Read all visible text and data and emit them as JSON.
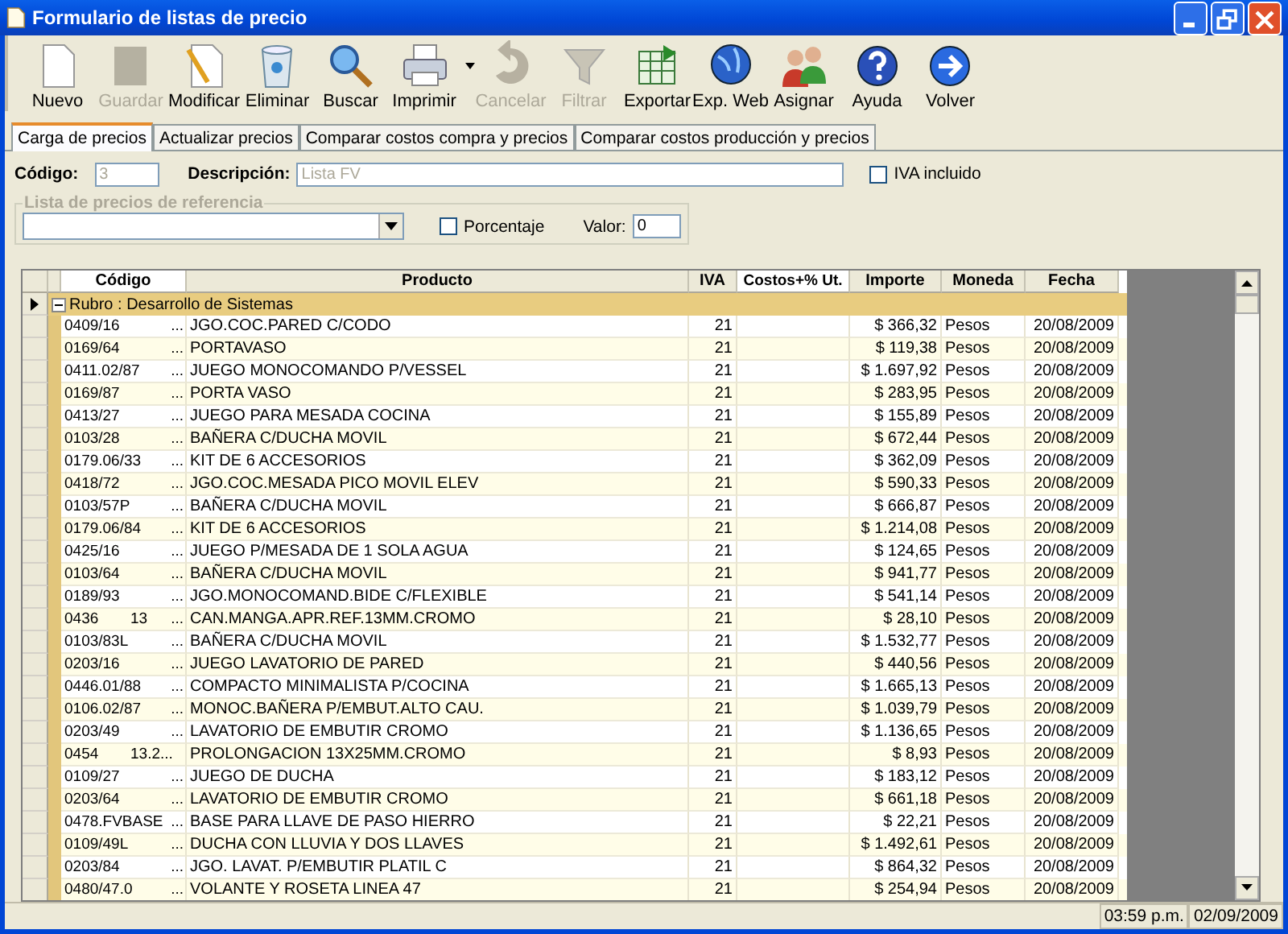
{
  "window": {
    "title": "Formulario de listas de precio"
  },
  "toolbar": [
    {
      "label": "Nuevo",
      "kind": "new",
      "disabled": false
    },
    {
      "label": "Guardar",
      "kind": "save",
      "disabled": true
    },
    {
      "label": "Modificar",
      "kind": "edit",
      "disabled": false
    },
    {
      "label": "Eliminar",
      "kind": "delete",
      "disabled": false
    },
    {
      "label": "Buscar",
      "kind": "search",
      "disabled": false
    },
    {
      "label": "Imprimir",
      "kind": "print",
      "disabled": false
    },
    {
      "label": "Cancelar",
      "kind": "cancel",
      "disabled": true
    },
    {
      "label": "Filtrar",
      "kind": "filter",
      "disabled": true
    },
    {
      "label": "Exportar",
      "kind": "export",
      "disabled": false
    },
    {
      "label": "Exp. Web",
      "kind": "web",
      "disabled": false
    },
    {
      "label": "Asignar",
      "kind": "assign",
      "disabled": false
    },
    {
      "label": "Ayuda",
      "kind": "help",
      "disabled": false
    },
    {
      "label": "Volver",
      "kind": "back",
      "disabled": false
    }
  ],
  "tabs": [
    {
      "label": "Carga de precios",
      "selected": true
    },
    {
      "label": "Actualizar precios",
      "selected": false
    },
    {
      "label": "Comparar costos compra y precios",
      "selected": false
    },
    {
      "label": "Comparar costos producción y precios",
      "selected": false
    }
  ],
  "form": {
    "codigo_label": "Código:",
    "codigo_value": "3",
    "descripcion_label": "Descripción:",
    "descripcion_value": "Lista FV",
    "iva_label": "IVA incluido",
    "iva_checked": false,
    "reference_group": {
      "legend": "Lista de precios de referencia",
      "porcentaje_label": "Porcentaje",
      "porcentaje_checked": false,
      "valor_label": "Valor:",
      "valor_value": "0"
    }
  },
  "table": {
    "columns": [
      "Código",
      "Producto",
      "IVA",
      "Costos+% Ut.",
      "Importe",
      "Moneda",
      "Fecha"
    ],
    "group": {
      "label": "Rubro : Desarrollo de Sistemas",
      "expanded": true
    },
    "rows": [
      {
        "code": "0409/16",
        "code_2": "",
        "lookup": "...",
        "product": "JGO.COC.PARED C/CODO",
        "iva": "21",
        "importe": "$ 366,32",
        "moneda": "Pesos",
        "fecha": "20/08/2009"
      },
      {
        "code": "0169/64",
        "code_2": "",
        "lookup": "...",
        "product": "PORTAVASO",
        "iva": "21",
        "importe": "$ 119,38",
        "moneda": "Pesos",
        "fecha": "20/08/2009"
      },
      {
        "code": "0411.02/87",
        "code_2": "",
        "lookup": "...",
        "product": "JUEGO MONOCOMANDO P/VESSEL",
        "iva": "21",
        "importe": "$ 1.697,92",
        "moneda": "Pesos",
        "fecha": "20/08/2009"
      },
      {
        "code": "0169/87",
        "code_2": "",
        "lookup": "...",
        "product": "PORTA VASO",
        "iva": "21",
        "importe": "$ 283,95",
        "moneda": "Pesos",
        "fecha": "20/08/2009"
      },
      {
        "code": "0413/27",
        "code_2": "",
        "lookup": "...",
        "product": "JUEGO PARA MESADA COCINA",
        "iva": "21",
        "importe": "$ 155,89",
        "moneda": "Pesos",
        "fecha": "20/08/2009"
      },
      {
        "code": "0103/28",
        "code_2": "",
        "lookup": "...",
        "product": "BAÑERA C/DUCHA MOVIL",
        "iva": "21",
        "importe": "$ 672,44",
        "moneda": "Pesos",
        "fecha": "20/08/2009"
      },
      {
        "code": "0179.06/33",
        "code_2": "",
        "lookup": "...",
        "product": "KIT DE 6 ACCESORIOS",
        "iva": "21",
        "importe": "$ 362,09",
        "moneda": "Pesos",
        "fecha": "20/08/2009"
      },
      {
        "code": "0418/72",
        "code_2": "",
        "lookup": "...",
        "product": "JGO.COC.MESADA PICO MOVIL ELEV",
        "iva": "21",
        "importe": "$ 590,33",
        "moneda": "Pesos",
        "fecha": "20/08/2009"
      },
      {
        "code": "0103/57P",
        "code_2": "",
        "lookup": "...",
        "product": "BAÑERA C/DUCHA MOVIL",
        "iva": "21",
        "importe": "$ 666,87",
        "moneda": "Pesos",
        "fecha": "20/08/2009"
      },
      {
        "code": "0179.06/84",
        "code_2": "",
        "lookup": "...",
        "product": "KIT DE 6 ACCESORIOS",
        "iva": "21",
        "importe": "$ 1.214,08",
        "moneda": "Pesos",
        "fecha": "20/08/2009"
      },
      {
        "code": "0425/16",
        "code_2": "",
        "lookup": "...",
        "product": "JUEGO P/MESADA DE 1 SOLA AGUA",
        "iva": "21",
        "importe": "$ 124,65",
        "moneda": "Pesos",
        "fecha": "20/08/2009"
      },
      {
        "code": "0103/64",
        "code_2": "",
        "lookup": "...",
        "product": "BAÑERA C/DUCHA MOVIL",
        "iva": "21",
        "importe": "$ 941,77",
        "moneda": "Pesos",
        "fecha": "20/08/2009"
      },
      {
        "code": "0189/93",
        "code_2": "",
        "lookup": "...",
        "product": "JGO.MONOCOMAND.BIDE C/FLEXIBLE",
        "iva": "21",
        "importe": "$ 541,14",
        "moneda": "Pesos",
        "fecha": "20/08/2009"
      },
      {
        "code": "0436",
        "code_2": "13",
        "lookup": "...",
        "product": "CAN.MANGA.APR.REF.13MM.CROMO",
        "iva": "21",
        "importe": "$ 28,10",
        "moneda": "Pesos",
        "fecha": "20/08/2009"
      },
      {
        "code": "0103/83L",
        "code_2": "",
        "lookup": "...",
        "product": "BAÑERA C/DUCHA MOVIL",
        "iva": "21",
        "importe": "$ 1.532,77",
        "moneda": "Pesos",
        "fecha": "20/08/2009"
      },
      {
        "code": "0203/16",
        "code_2": "",
        "lookup": "...",
        "product": "JUEGO LAVATORIO DE PARED",
        "iva": "21",
        "importe": "$ 440,56",
        "moneda": "Pesos",
        "fecha": "20/08/2009"
      },
      {
        "code": "0446.01/88",
        "code_2": "",
        "lookup": "...",
        "product": "COMPACTO MINIMALISTA P/COCINA",
        "iva": "21",
        "importe": "$ 1.665,13",
        "moneda": "Pesos",
        "fecha": "20/08/2009"
      },
      {
        "code": "0106.02/87",
        "code_2": "",
        "lookup": "...",
        "product": "MONOC.BAÑERA P/EMBUT.ALTO CAU.",
        "iva": "21",
        "importe": "$ 1.039,79",
        "moneda": "Pesos",
        "fecha": "20/08/2009"
      },
      {
        "code": "0203/49",
        "code_2": "",
        "lookup": "...",
        "product": "LAVATORIO DE EMBUTIR CROMO",
        "iva": "21",
        "importe": "$ 1.136,65",
        "moneda": "Pesos",
        "fecha": "20/08/2009"
      },
      {
        "code": "0454",
        "code_2": "13.2...",
        "lookup": "",
        "product": "PROLONGACION 13X25MM.CROMO",
        "iva": "21",
        "importe": "$ 8,93",
        "moneda": "Pesos",
        "fecha": "20/08/2009"
      },
      {
        "code": "0109/27",
        "code_2": "",
        "lookup": "...",
        "product": "JUEGO DE DUCHA",
        "iva": "21",
        "importe": "$ 183,12",
        "moneda": "Pesos",
        "fecha": "20/08/2009"
      },
      {
        "code": "0203/64",
        "code_2": "",
        "lookup": "...",
        "product": "LAVATORIO DE EMBUTIR CROMO",
        "iva": "21",
        "importe": "$ 661,18",
        "moneda": "Pesos",
        "fecha": "20/08/2009"
      },
      {
        "code": "0478.FVBASE",
        "code_2": "",
        "lookup": "...",
        "product": "BASE PARA LLAVE DE PASO HIERRO",
        "iva": "21",
        "importe": "$ 22,21",
        "moneda": "Pesos",
        "fecha": "20/08/2009"
      },
      {
        "code": "0109/49L",
        "code_2": "",
        "lookup": "...",
        "product": "DUCHA CON LLUVIA Y DOS LLAVES",
        "iva": "21",
        "importe": "$ 1.492,61",
        "moneda": "Pesos",
        "fecha": "20/08/2009"
      },
      {
        "code": "0203/84",
        "code_2": "",
        "lookup": "...",
        "product": "JGO. LAVAT. P/EMBUTIR PLATIL C",
        "iva": "21",
        "importe": "$ 864,32",
        "moneda": "Pesos",
        "fecha": "20/08/2009"
      },
      {
        "code": "0480/47.0",
        "code_2": "",
        "lookup": "...",
        "product": "VOLANTE Y ROSETA LINEA 47",
        "iva": "21",
        "importe": "$ 254,94",
        "moneda": "Pesos",
        "fecha": "20/08/2009"
      }
    ]
  },
  "status_bar": {
    "time": "03:59 p.m.",
    "date": "02/09/2009"
  }
}
